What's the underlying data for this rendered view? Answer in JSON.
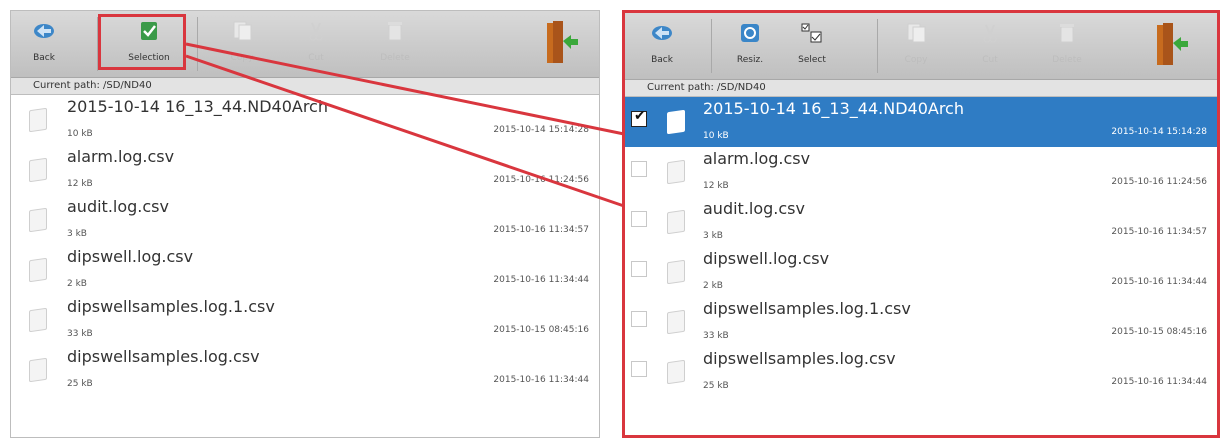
{
  "left": {
    "toolbar": {
      "back": "Back",
      "selection": "Selection",
      "copy": "Copy",
      "cut": "Cut",
      "delete": "Delete"
    },
    "path": "Current path: /SD/ND40",
    "files": [
      {
        "name": "2015-10-14 16_13_44.ND40Arch",
        "size": "10 kB",
        "date": "2015-10-14 15:14:28"
      },
      {
        "name": "alarm.log.csv",
        "size": "12 kB",
        "date": "2015-10-16 11:24:56"
      },
      {
        "name": "audit.log.csv",
        "size": "3 kB",
        "date": "2015-10-16 11:34:57"
      },
      {
        "name": "dipswell.log.csv",
        "size": "2 kB",
        "date": "2015-10-16 11:34:44"
      },
      {
        "name": "dipswellsamples.log.1.csv",
        "size": "33 kB",
        "date": "2015-10-15 08:45:16"
      },
      {
        "name": "dipswellsamples.log.csv",
        "size": "25 kB",
        "date": "2015-10-16 11:34:44"
      }
    ]
  },
  "right": {
    "toolbar": {
      "back": "Back",
      "resize": "Resiz.",
      "select": "Select",
      "copy": "Copy",
      "cut": "Cut",
      "delete": "Delete"
    },
    "path": "Current path: /SD/ND40",
    "files": [
      {
        "name": "2015-10-14 16_13_44.ND40Arch",
        "size": "10 kB",
        "date": "2015-10-14 15:14:28",
        "selected": true
      },
      {
        "name": "alarm.log.csv",
        "size": "12 kB",
        "date": "2015-10-16 11:24:56"
      },
      {
        "name": "audit.log.csv",
        "size": "3 kB",
        "date": "2015-10-16 11:34:57"
      },
      {
        "name": "dipswell.log.csv",
        "size": "2 kB",
        "date": "2015-10-16 11:34:44"
      },
      {
        "name": "dipswellsamples.log.1.csv",
        "size": "33 kB",
        "date": "2015-10-15 08:45:16"
      },
      {
        "name": "dipswellsamples.log.csv",
        "size": "25 kB",
        "date": "2015-10-16 11:34:44"
      }
    ]
  },
  "colors": {
    "annotation": "#d9363e",
    "selection": "#2f7cc4",
    "toolbar": "#cfcfcf"
  }
}
